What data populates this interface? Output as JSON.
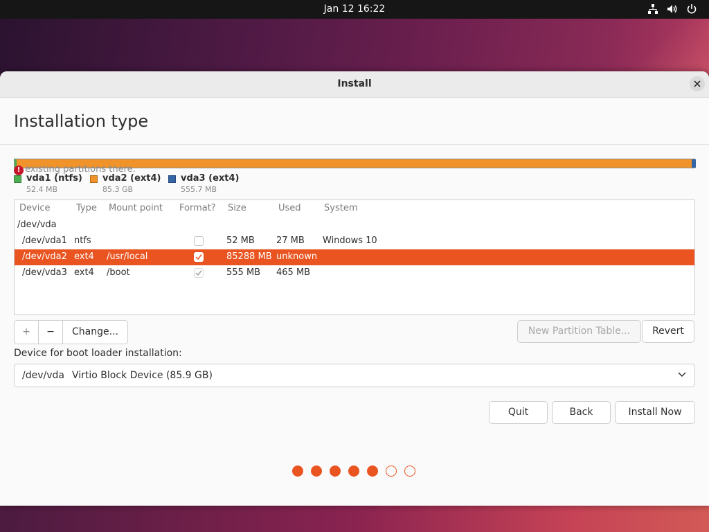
{
  "topbar": {
    "clock": "Jan 12  16:22",
    "icons": [
      "network-icon",
      "volume-icon",
      "power-icon"
    ]
  },
  "window": {
    "title": "Install",
    "heading": "Installation type"
  },
  "partition_bar": {
    "segments": [
      {
        "name": "vda1",
        "color": "#4cb050",
        "size_mb": 52.4
      },
      {
        "name": "vda2",
        "color": "#f0932b",
        "size_mb": 85300
      },
      {
        "name": "vda3",
        "color": "#3465a4",
        "size_mb": 555.7
      }
    ]
  },
  "warning": {
    "text": "existing partitions there."
  },
  "legend": [
    {
      "label": "vda1 (ntfs)",
      "size": "52.4 MB",
      "color": "#4cb050"
    },
    {
      "label": "vda2 (ext4)",
      "size": "85.3 GB",
      "color": "#f0932b"
    },
    {
      "label": "vda3 (ext4)",
      "size": "555.7 MB",
      "color": "#3465a4"
    }
  ],
  "table": {
    "headers": {
      "device": "Device",
      "type": "Type",
      "mount": "Mount point",
      "format": "Format?",
      "size": "Size",
      "used": "Used",
      "system": "System"
    },
    "disk": "/dev/vda",
    "rows": [
      {
        "device": "/dev/vda1",
        "type": "ntfs",
        "mount": "",
        "format": false,
        "size": "52 MB",
        "used": "27 MB",
        "system": "Windows 10",
        "selected": false
      },
      {
        "device": "/dev/vda2",
        "type": "ext4",
        "mount": "/usr/local",
        "format": true,
        "size": "85288 MB",
        "used": "unknown",
        "system": "",
        "selected": true
      },
      {
        "device": "/dev/vda3",
        "type": "ext4",
        "mount": "/boot",
        "format": true,
        "size": "555 MB",
        "used": "465 MB",
        "system": "",
        "selected": false
      }
    ]
  },
  "toolbar": {
    "add_label": "+",
    "remove_label": "−",
    "change_label": "Change...",
    "new_table_label": "New Partition Table...",
    "revert_label": "Revert"
  },
  "bootloader": {
    "label": "Device for boot loader installation:",
    "device": "/dev/vda",
    "description": "Virtio Block Device (85.9 GB)"
  },
  "actions": {
    "quit": "Quit",
    "back": "Back",
    "install": "Install Now"
  },
  "progress": {
    "total_steps": 7,
    "completed_steps": 5
  }
}
